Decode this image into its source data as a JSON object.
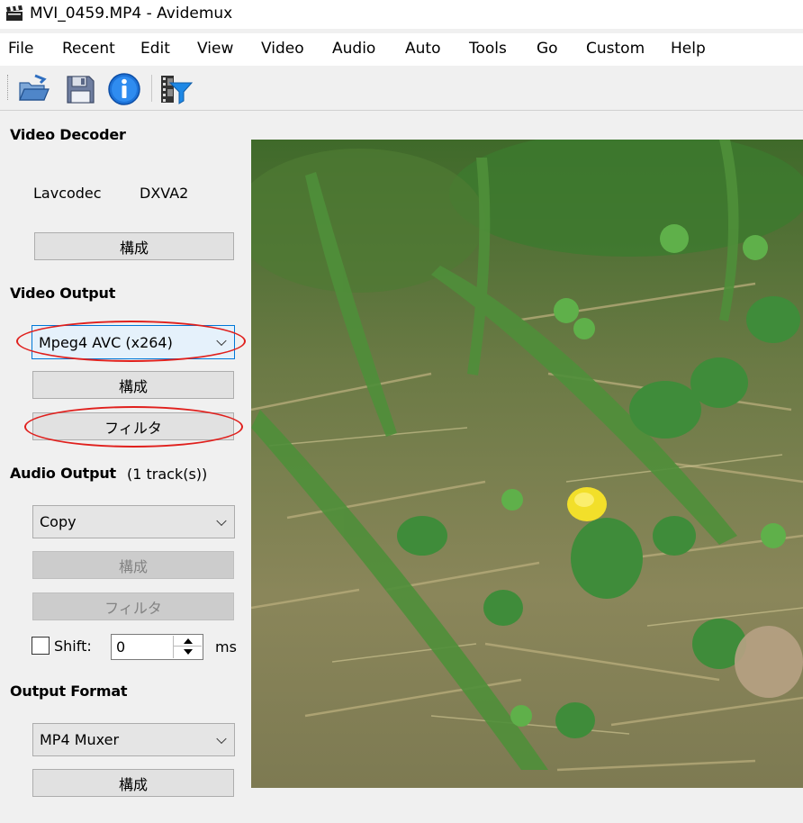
{
  "window": {
    "title": "MVI_0459.MP4 - Avidemux"
  },
  "menu": [
    "File",
    "Recent",
    "Edit",
    "View",
    "Video",
    "Audio",
    "Auto",
    "Tools",
    "Go",
    "Custom",
    "Help"
  ],
  "toolbar": {
    "icons": [
      "open-folder-icon",
      "save-floppy-icon",
      "info-icon",
      "film-filter-icon"
    ]
  },
  "video_decoder": {
    "title": "Video Decoder",
    "decoder": "Lavcodec",
    "hw": "DXVA2",
    "configure": "構成"
  },
  "video_output": {
    "title": "Video Output",
    "codec": "Mpeg4 AVC (x264)",
    "configure": "構成",
    "filters": "フィルタ"
  },
  "audio_output": {
    "title": "Audio Output",
    "tracks": "(1 track(s))",
    "codec": "Copy",
    "configure": "構成",
    "filters": "フィルタ",
    "shift_label": "Shift:",
    "shift_value": "0",
    "shift_unit": "ms"
  },
  "output_format": {
    "title": "Output Format",
    "muxer": "MP4 Muxer",
    "configure": "構成"
  },
  "annotations": {
    "color": "#e0201d"
  }
}
